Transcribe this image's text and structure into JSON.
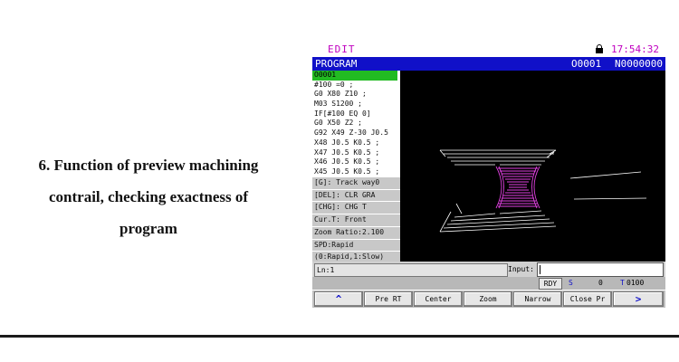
{
  "caption": {
    "line1": "6. Function of preview machining",
    "line2": "contrail, checking exactness of",
    "line3": "program"
  },
  "screen": {
    "mode": "EDIT",
    "lock_icon": "lock-icon",
    "time": "17:54:32",
    "title": "PROGRAM",
    "program_number": "O0001",
    "block_number": "N0000000",
    "code_lines": [
      "O0001",
      "#100 =0 ;",
      "G0 X80 Z10 ;",
      "M03 S1200 ;",
      "IF[#100 EQ 0]",
      "G0 X50 Z2 ;",
      "G92 X49 Z-30 J0.5",
      "X48 J0.5 K0.5 ;",
      "X47 J0.5 K0.5 ;",
      "X46 J0.5 K0.5 ;",
      "X45 J0.5 K0.5 ;"
    ],
    "info": [
      "[G]: Track way0",
      "[DEL]: CLR GRA",
      "[CHG]: CHG T",
      "Cur.T: Front",
      "Zoom Ratio:2.100",
      "SPD:Rapid",
      "(0:Rapid,1:Slow)"
    ],
    "line_number": "Ln:1",
    "input_label": "Input:",
    "input_value": "",
    "status": "RDY",
    "s_label": "S",
    "s_value": "0",
    "t_label": "T",
    "t_value": "0100",
    "softkeys": {
      "up": "^",
      "pre_rt": "Pre RT",
      "center": "Center",
      "zoom": "Zoom",
      "narrow": "Narrow",
      "close_pr": "Close Pr",
      "next": ">"
    },
    "colors": {
      "title_bar": "#1010c8",
      "mode_text": "#c000c0",
      "highlight": "#22bb22",
      "toolpath_white": "#ffffff",
      "toolpath_magenta": "#e040e0"
    }
  }
}
